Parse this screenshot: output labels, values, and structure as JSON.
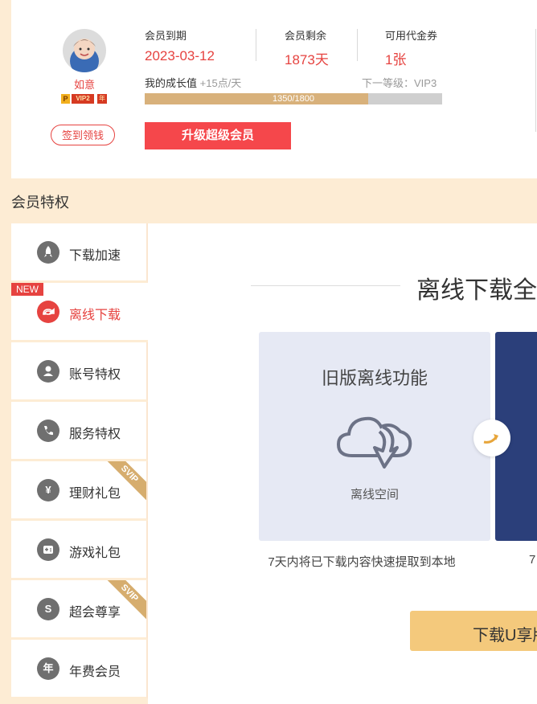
{
  "user": {
    "name": "如意",
    "badges": {
      "p": "P",
      "vip": "VIP2",
      "year": "年"
    },
    "sign_label": "签到领钱"
  },
  "stats": [
    {
      "label": "会员到期",
      "value": "2023-03-12"
    },
    {
      "label": "会员剩余",
      "value": "1873天"
    },
    {
      "label": "可用代金券",
      "value": "1张"
    }
  ],
  "growth": {
    "label": "我的成长值",
    "increment": "+15点/天",
    "next_level": "下一等级：VIP3",
    "progress_text": "1350/1800",
    "current": 1350,
    "max": 1800
  },
  "upgrade_label": "升级超级会员",
  "section_title": "会员特权",
  "sidebar": [
    {
      "label": "下载加速",
      "icon": "rocket-icon",
      "glyph": ""
    },
    {
      "label": "离线下载",
      "icon": "offline-icon",
      "glyph": "",
      "tag": "NEW",
      "active": true
    },
    {
      "label": "账号特权",
      "icon": "user-icon",
      "glyph": ""
    },
    {
      "label": "服务特权",
      "icon": "phone-icon",
      "glyph": ""
    },
    {
      "label": "理财礼包",
      "icon": "yen-icon",
      "glyph": "¥",
      "corner": "SVIP"
    },
    {
      "label": "游戏礼包",
      "icon": "gamepad-icon",
      "glyph": ""
    },
    {
      "label": "超会尊享",
      "icon": "s-icon",
      "glyph": "S",
      "corner": "SVIP"
    },
    {
      "label": "年费会员",
      "icon": "year-icon",
      "glyph": "年"
    }
  ],
  "main": {
    "title": "离线下载全",
    "card1_title": "旧版离线功能",
    "card1_subtitle": "离线空间",
    "desc1": "7天内将已下载内容快速提取到本地",
    "desc2": "7",
    "button_label": "下载U享版"
  },
  "colors": {
    "accent": "#e64340",
    "gold": "#d8b17b",
    "button": "#f5474b",
    "bg": "#fdecd4"
  }
}
